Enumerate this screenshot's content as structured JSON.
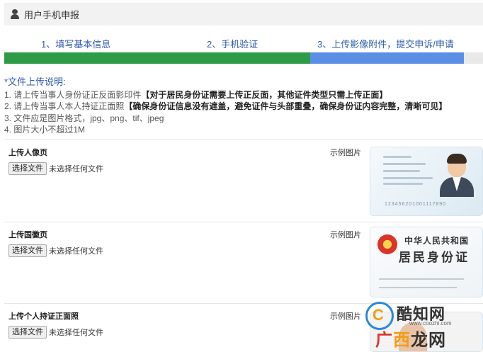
{
  "header": {
    "title": "用户手机申报"
  },
  "steps": [
    {
      "label": "1、填写基本信息"
    },
    {
      "label": "2、手机验证"
    },
    {
      "label": "3、上传影像附件，提交申诉/申请"
    }
  ],
  "progress": {
    "completed_steps": 3,
    "total_steps": 3,
    "colors": {
      "done": "#2e9b46",
      "current": "#5b8fe6",
      "track": "#e9e9e9"
    }
  },
  "instructions": {
    "title": "*文件上传说明:",
    "lines": [
      {
        "text": "1. 请上传当事人身份证正反面影印件",
        "bold": "【对于居民身份证需要上传正反面，其他证件类型只需上传正面】"
      },
      {
        "text": "2. 请上传当事人本人持证正面照",
        "bold": "【确保身份证信息没有遮盖，避免证件与头部重叠，确保身份证内容完整，清晰可见】"
      },
      {
        "text": "3. 文件应是图片格式，jpg、png、tif、jpeg",
        "bold": ""
      },
      {
        "text": "4. 图片大小不超过1M",
        "bold": ""
      }
    ]
  },
  "uploads": [
    {
      "label": "上传人像页",
      "button": "选择文件",
      "status": "未选择任何文件",
      "sample_label": "示例图片"
    },
    {
      "label": "上传国徽页",
      "button": "选择文件",
      "status": "未选择任何文件",
      "sample_label": "示例图片"
    },
    {
      "label": "上传个人持证正面照",
      "button": "选择文件",
      "status": "未选择任何文件",
      "sample_label": "示例图片"
    }
  ],
  "sample_front": {
    "number": "123456201001117890"
  },
  "sample_back": {
    "title": "中华人民共和国",
    "subtitle": "居民身份证"
  },
  "watermark": {
    "brand": "酷知网",
    "url": "www.coozhi.com",
    "brand2_a": "广",
    "brand2_b": "西",
    "brand2_c": "龙网"
  }
}
